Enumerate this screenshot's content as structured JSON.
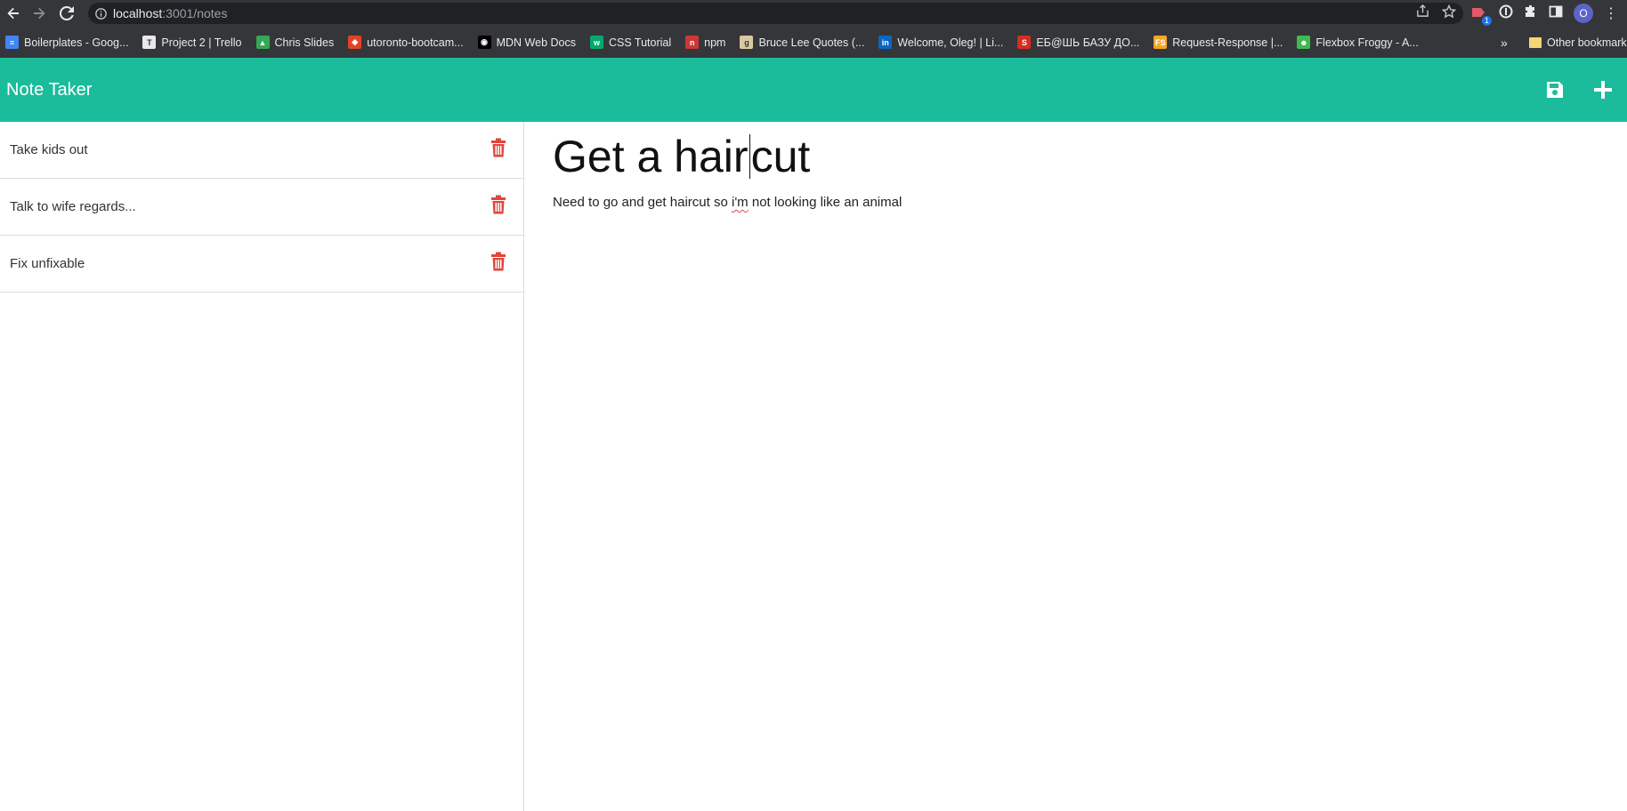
{
  "browser": {
    "url_host": "localhost",
    "url_path": ":3001/notes",
    "extension_badge": "1",
    "profile_initial": "O"
  },
  "bookmarks": {
    "items": [
      {
        "label": "Boilerplates - Goog...",
        "icon": "docs-icon",
        "color": "#4285f4",
        "glyph": "≡"
      },
      {
        "label": "Project 2 | Trello",
        "icon": "trello-icon",
        "color": "#e8e8e8",
        "glyph": "T"
      },
      {
        "label": "Chris Slides",
        "icon": "drive-icon",
        "color": "#34a853",
        "glyph": "▲"
      },
      {
        "label": "utoronto-bootcam...",
        "icon": "gitlab-icon",
        "color": "#e24329",
        "glyph": "◆"
      },
      {
        "label": "MDN Web Docs",
        "icon": "mdn-icon",
        "color": "#000000",
        "glyph": "◉"
      },
      {
        "label": "CSS Tutorial",
        "icon": "w3schools-icon",
        "color": "#04aa6d",
        "glyph": "w"
      },
      {
        "label": "npm",
        "icon": "npm-icon",
        "color": "#cb3837",
        "glyph": "n"
      },
      {
        "label": "Bruce Lee Quotes (...",
        "icon": "goodreads-icon",
        "color": "#d9c9a3",
        "glyph": "g"
      },
      {
        "label": "Welcome, Oleg! | Li...",
        "icon": "linkedin-icon",
        "color": "#0a66c2",
        "glyph": "in"
      },
      {
        "label": "ЕБ@ШЬ БАЗУ ДО...",
        "icon": "superman-icon",
        "color": "#d62d20",
        "glyph": "S"
      },
      {
        "label": "Request-Response |...",
        "icon": "fullstack-icon",
        "color": "#f5a623",
        "glyph": "FS"
      },
      {
        "label": "Flexbox Froggy - A...",
        "icon": "frog-icon",
        "color": "#3fb950",
        "glyph": "☻"
      }
    ],
    "more": "»",
    "other": "Other bookmarks"
  },
  "app": {
    "title": "Note Taker",
    "accent_color": "#1bbc9b",
    "delete_color": "#e0463b"
  },
  "notes": [
    {
      "title": "Take kids out"
    },
    {
      "title": "Talk to wife regards..."
    },
    {
      "title": "Fix unfixable"
    }
  ],
  "active_note": {
    "title_before_caret": "Get a hair",
    "title_after_caret": "cut",
    "text_before": "Need to go and get haircut so ",
    "text_misspelled": "i'm",
    "text_after": " not looking like an animal"
  }
}
